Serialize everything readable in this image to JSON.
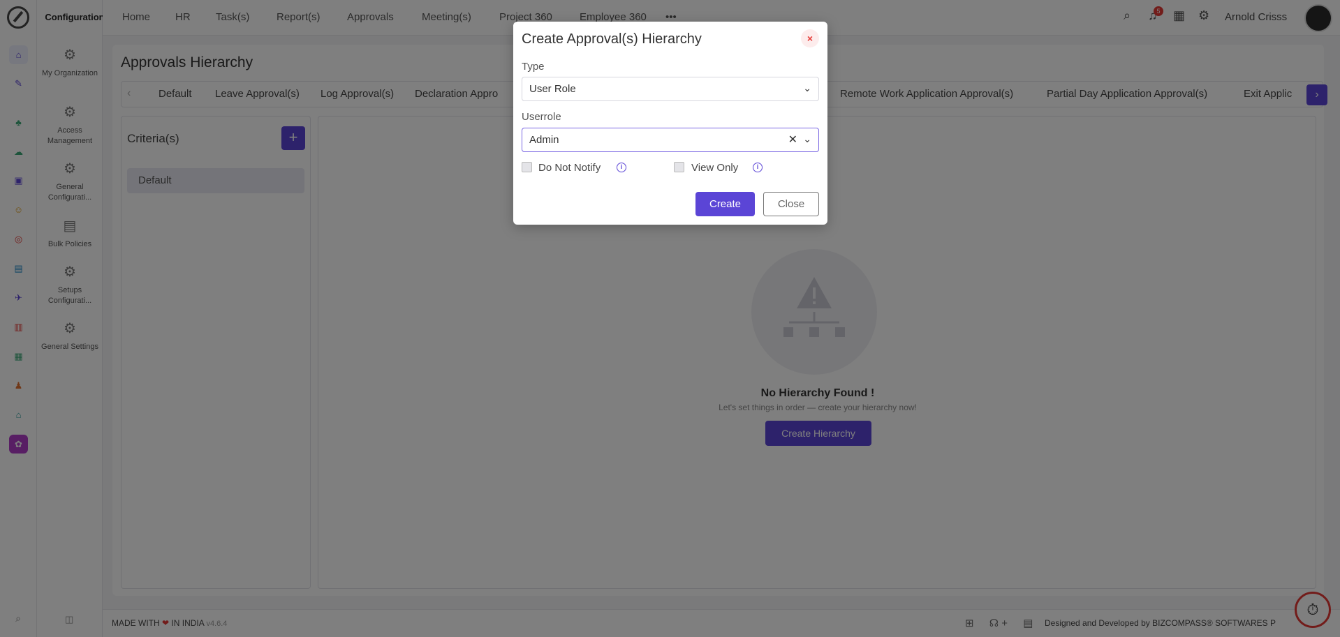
{
  "app": {
    "panel_title": "Configuration"
  },
  "config_menu": [
    {
      "label": "My Organization",
      "icon": "gear-icon"
    },
    {
      "label": "Access Management",
      "icon": "gear-icon"
    },
    {
      "label": "General Configurati...",
      "icon": "gear-icon"
    },
    {
      "label": "Bulk Policies",
      "icon": "document-gear-icon"
    },
    {
      "label": "Setups Configurati...",
      "icon": "gear-icon"
    },
    {
      "label": "General Settings",
      "icon": "gear-icon"
    }
  ],
  "topnav": {
    "items": [
      "Home",
      "HR",
      "Task(s)",
      "Report(s)",
      "Approvals",
      "Meeting(s)",
      "Project 360",
      "Employee 360"
    ],
    "more": "•••",
    "notification_count": "5",
    "user_name": "Arnold Crisss"
  },
  "page": {
    "title": "Approvals Hierarchy",
    "tabs": [
      "Default",
      "Leave Approval(s)",
      "Log Approval(s)",
      "Declaration Appro",
      "Remote Work Application Approval(s)",
      "Partial Day Application Approval(s)",
      "Exit Applic"
    ]
  },
  "criteria": {
    "title": "Criteria(s)",
    "add_label": "+",
    "items": [
      "Default"
    ]
  },
  "empty_state": {
    "title": "No Hierarchy Found !",
    "subtitle": "Let's set things in order — create your hierarchy now!",
    "button": "Create Hierarchy"
  },
  "footer": {
    "made_with": "MADE WITH",
    "heart": "❤",
    "in_india": "IN INDIA",
    "version": "v4.6.4",
    "credit": "Designed and Developed by  BIZCOMPASS® SOFTWARES P"
  },
  "modal": {
    "title": "Create Approval(s) Hierarchy",
    "close_icon": "×",
    "type_label": "Type",
    "type_value": "User Role",
    "userrole_label": "Userrole",
    "userrole_value": "Admin",
    "do_not_notify_label": "Do Not Notify",
    "view_only_label": "View Only",
    "create_button": "Create",
    "close_button": "Close"
  },
  "colors": {
    "accent": "#5b45d6",
    "danger": "#e53935"
  }
}
